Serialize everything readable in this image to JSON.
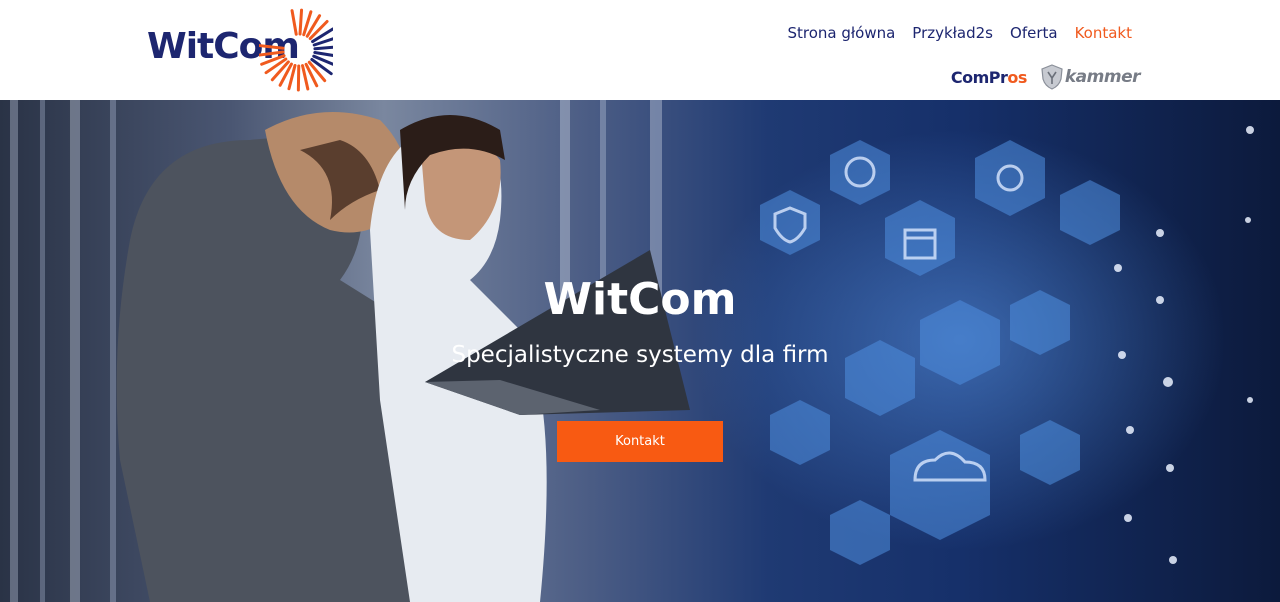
{
  "header": {
    "logo": {
      "text": "WitCom"
    },
    "nav": [
      {
        "label": "Strona główna",
        "active": false
      },
      {
        "label": "Przykład2s",
        "active": false
      },
      {
        "label": "Oferta",
        "active": false
      },
      {
        "label": "Kontakt",
        "active": true
      }
    ],
    "partners": {
      "compros_main": "ComPr",
      "compros_accent": "os",
      "kammer": "kammer"
    }
  },
  "hero": {
    "title": "WitCom",
    "subtitle": "Specjalistyczne systemy dla firm",
    "button_label": "Kontakt"
  },
  "colors": {
    "brand_navy": "#1d2670",
    "brand_orange": "#f05a1e",
    "button_orange": "#f85a12"
  }
}
